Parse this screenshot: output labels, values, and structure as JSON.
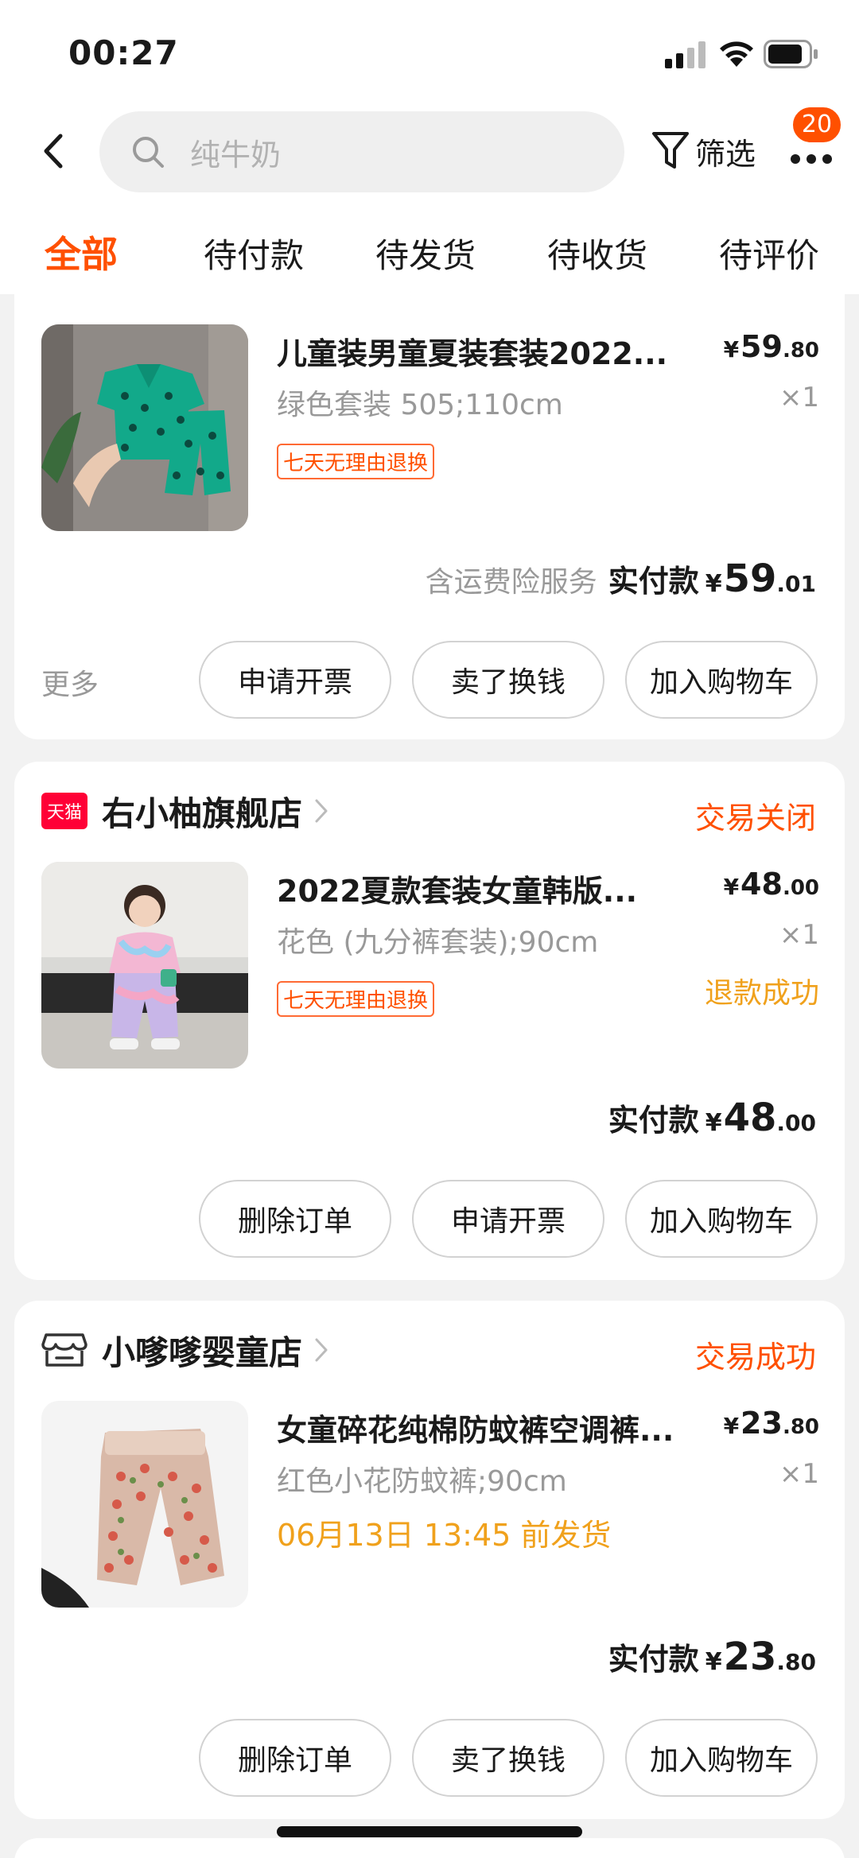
{
  "status_bar": {
    "time": "00:27"
  },
  "header": {
    "search_placeholder": "纯牛奶",
    "filter_label": "筛选",
    "more_badge": "20"
  },
  "tabs": [
    {
      "label": "全部",
      "active": true
    },
    {
      "label": "待付款"
    },
    {
      "label": "待发货"
    },
    {
      "label": "待收货"
    },
    {
      "label": "待评价"
    }
  ],
  "orders": [
    {
      "item": {
        "title": "儿童装男童夏装套装2022...",
        "price_currency": "¥",
        "price_int": "59",
        "price_dec": ".80",
        "sku": "绿色套装 505;110cm",
        "qty": "×1",
        "return_tag": "七天无理由退换"
      },
      "total": {
        "service": "含运费险服务",
        "label": "实付款",
        "currency": "¥",
        "int": "59",
        "dec": ".01"
      },
      "more_link": "更多",
      "actions": [
        "申请开票",
        "卖了换钱",
        "加入购物车"
      ]
    },
    {
      "shop": {
        "logo": "tmall-logo",
        "logo_text": "天猫",
        "name": "右小柚旗舰店"
      },
      "status": "交易关闭",
      "item": {
        "title": "2022夏款套装女童韩版...",
        "price_currency": "¥",
        "price_int": "48",
        "price_dec": ".00",
        "sku": "花色 (九分裤套装);90cm",
        "qty": "×1",
        "return_tag": "七天无理由退换",
        "refund_status": "退款成功"
      },
      "total": {
        "label": "实付款",
        "currency": "¥",
        "int": "48",
        "dec": ".00"
      },
      "actions": [
        "删除订单",
        "申请开票",
        "加入购物车"
      ]
    },
    {
      "shop": {
        "logo": "store-icon",
        "name": "小嗲嗲婴童店"
      },
      "status": "交易成功",
      "item": {
        "title": "女童碎花纯棉防蚊裤空调裤...",
        "price_currency": "¥",
        "price_int": "23",
        "price_dec": ".80",
        "sku": "红色小花防蚊裤;90cm",
        "qty": "×1",
        "ship_note": "06月13日 13:45 前发货"
      },
      "total": {
        "label": "实付款",
        "currency": "¥",
        "int": "23",
        "dec": ".80"
      },
      "actions": [
        "删除订单",
        "卖了换钱",
        "加入购物车"
      ]
    }
  ],
  "colors": {
    "accent": "#ff5000",
    "warn": "#f0a11c",
    "muted": "#999999"
  }
}
